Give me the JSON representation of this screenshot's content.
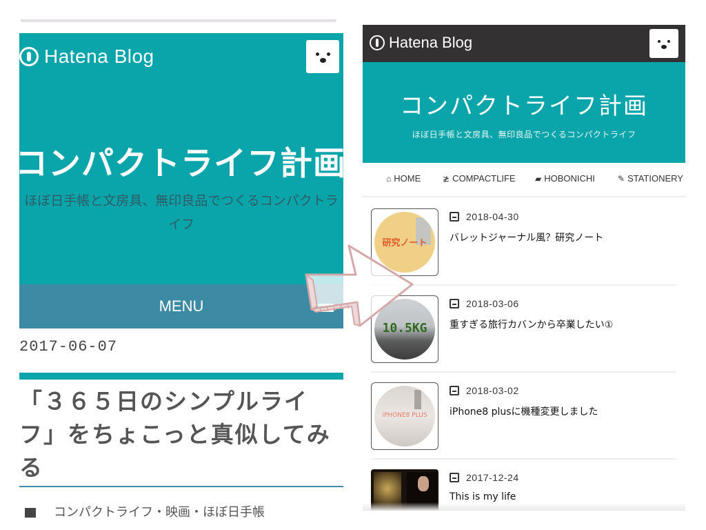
{
  "left": {
    "logo_text": "Hatena Blog",
    "blog_title": "コンパクトライフ計画",
    "blog_description": "ほぼ日手帳と文房具、無印良品でつくるコンパクトライフ",
    "menu_label": "MENU",
    "post_date": "2017-06-07",
    "post_title": "「３６５日のシンプルライフ」をちょこっと真似してみる",
    "category_text": "コンパクトライフ・映画・ほぼ日手帳"
  },
  "right": {
    "logo_text": "Hatena Blog",
    "blog_title": "コンパクトライフ計画",
    "blog_description": "ほぼ日手帳と文房具、無印良品でつくるコンパクトライフ",
    "nav": [
      {
        "icon": "home-icon",
        "label": "HOME"
      },
      {
        "icon": "compactlife-icon",
        "label": "COMPACTLIFE"
      },
      {
        "icon": "book-icon",
        "label": "HOBONICHI"
      },
      {
        "icon": "pencil-icon",
        "label": "STATIONERY"
      }
    ],
    "posts": [
      {
        "date": "2018-04-30",
        "title": "バレットジャーナル風？研究ノート",
        "thumb_text": "研究ノート"
      },
      {
        "date": "2018-03-06",
        "title": "重すぎる旅行カバンから卒業したい①",
        "thumb_text": "10.5KG"
      },
      {
        "date": "2018-03-02",
        "title": "iPhone8 plusに機種変更しました",
        "thumb_text": "iPHONE8 PLUS"
      },
      {
        "date": "2017-12-24",
        "title": "This is my life",
        "thumb_text": ""
      }
    ]
  },
  "colors": {
    "teal": "#0aa5aa",
    "menu_blue": "#3d8aa4",
    "dark_bar": "#333132",
    "arrow_outline": "#d4a8a8"
  }
}
